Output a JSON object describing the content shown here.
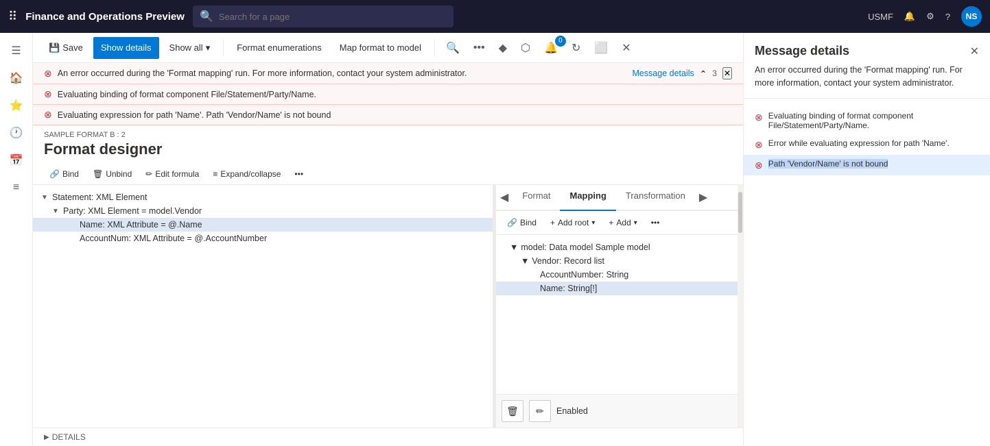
{
  "app": {
    "title": "Finance and Operations Preview",
    "env": "USMF"
  },
  "search": {
    "placeholder": "Search for a page"
  },
  "toolbar": {
    "save_label": "Save",
    "show_details_label": "Show details",
    "show_all_label": "Show all",
    "format_enumerations_label": "Format enumerations",
    "map_format_label": "Map format to model",
    "badge_count": "0"
  },
  "errors": {
    "main_error": "An error occurred during the 'Format mapping' run. For more information, contact your system administrator.",
    "error2": "Evaluating binding of format component File/Statement/Party/Name.",
    "error3": "Evaluating expression for path 'Name'.  Path 'Vendor/Name' is not bound",
    "message_details_link": "Message details",
    "error_count": "3"
  },
  "designer": {
    "sample_label": "SAMPLE FORMAT B : 2",
    "title": "Format designer"
  },
  "designer_toolbar": {
    "bind": "Bind",
    "unbind": "Unbind",
    "edit_formula": "Edit formula",
    "expand_collapse": "Expand/collapse"
  },
  "tree": {
    "statement": "Statement: XML Element",
    "party": "Party: XML Element = model.Vendor",
    "name": "Name: XML Attribute = @.Name",
    "account_num": "AccountNum: XML Attribute = @.AccountNumber"
  },
  "right_tabs": {
    "format": "Format",
    "mapping": "Mapping",
    "transformation": "Transformation"
  },
  "mapping_toolbar": {
    "bind": "Bind",
    "add_root": "Add root",
    "add": "Add"
  },
  "mapping_tree": {
    "model": "model: Data model Sample model",
    "vendor": "Vendor: Record list",
    "account_number": "AccountNumber: String",
    "name_string": "Name: String[!]"
  },
  "bottom": {
    "enabled": "Enabled"
  },
  "footer": {
    "details": "DETAILS"
  },
  "message_panel": {
    "title": "Message details",
    "description": "An error occurred during the 'Format mapping' run. For more information, contact your system administrator.",
    "error1": "Evaluating binding of format component File/Statement/Party/Name.",
    "error2": "Error while evaluating expression for path 'Name'.",
    "error3": "Path 'Vendor/Name' is not bound"
  }
}
